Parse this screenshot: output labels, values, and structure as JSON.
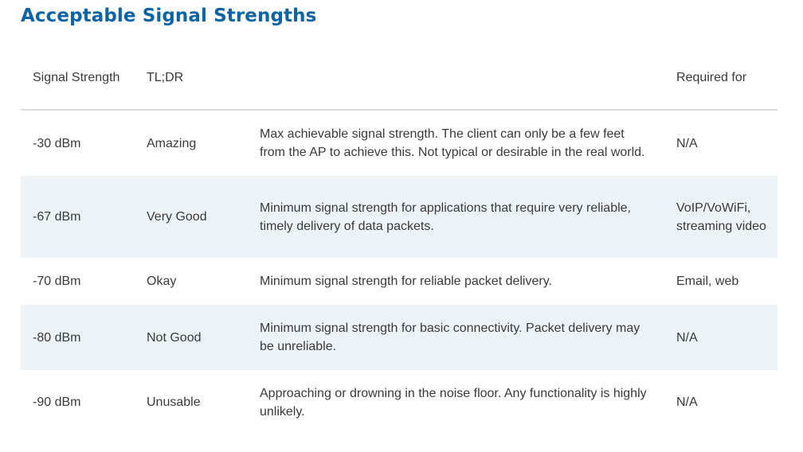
{
  "page": {
    "title": "Acceptable Signal Strengths"
  },
  "colors": {
    "title": "#0a64a8",
    "text": "#3a3a3a",
    "shaded_row": "#eef3f7",
    "header_rule": "#dcdcdc"
  },
  "table": {
    "headers": [
      "Signal Strength",
      "TL;DR",
      "",
      "Required for"
    ],
    "rows": [
      {
        "strength": "-30 dBm",
        "tldr": "Amazing",
        "description": "Max achievable signal strength. The client can only be a few feet from the AP to achieve this. Not typical or desirable in the real world.",
        "required_for": "N/A"
      },
      {
        "strength": "-67 dBm",
        "tldr": "Very Good",
        "description": "Minimum signal strength for applications that require very reliable, timely delivery of data packets.",
        "required_for": "VoIP/VoWiFi, streaming video"
      },
      {
        "strength": "-70 dBm",
        "tldr": "Okay",
        "description": "Minimum signal strength for reliable packet delivery.",
        "required_for": "Email, web"
      },
      {
        "strength": "-80 dBm",
        "tldr": "Not Good",
        "description": "Minimum signal strength for basic connectivity. Packet delivery may be unreliable.",
        "required_for": "N/A"
      },
      {
        "strength": "-90 dBm",
        "tldr": "Unusable",
        "description": "Approaching or drowning in the noise floor. Any functionality is highly unlikely.",
        "required_for": "N/A"
      }
    ]
  }
}
